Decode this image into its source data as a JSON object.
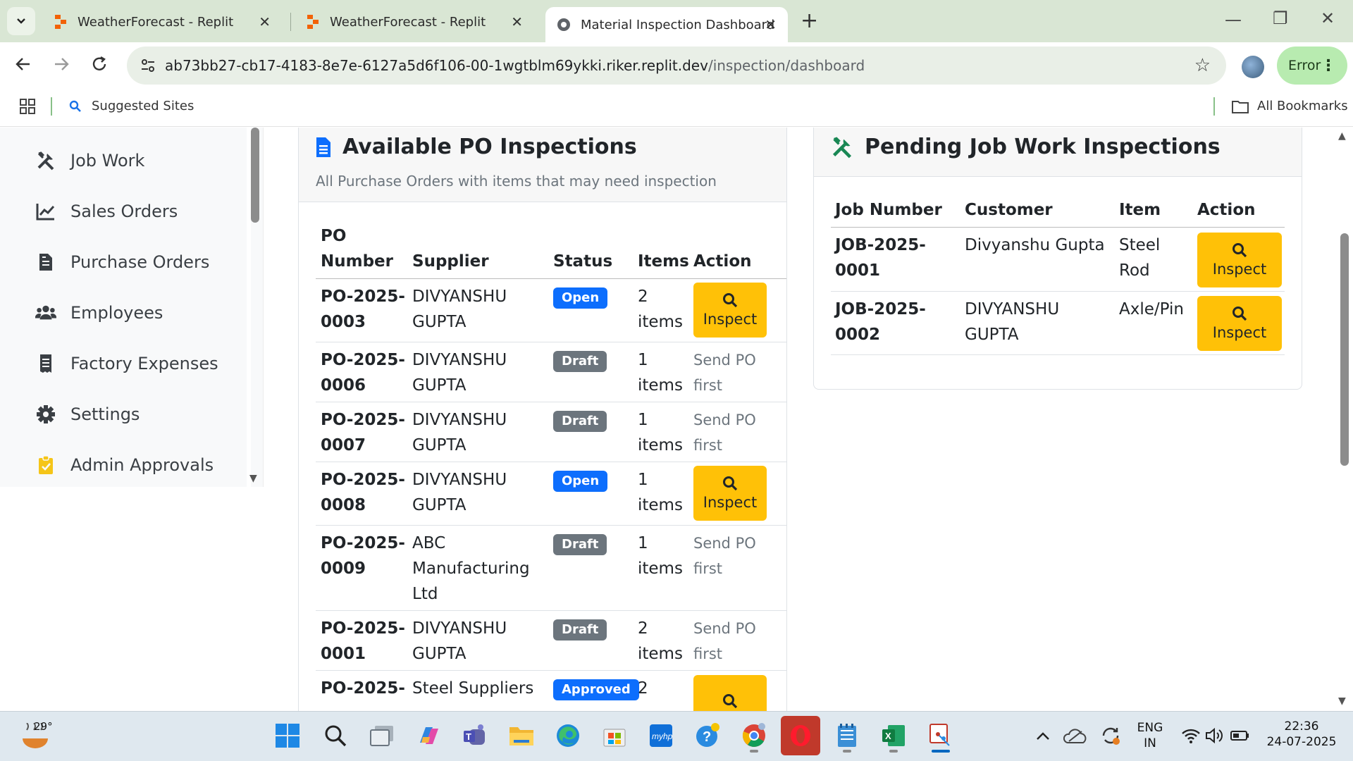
{
  "browser": {
    "tabs": [
      {
        "title": "WeatherForecast - Replit",
        "active": false
      },
      {
        "title": "WeatherForecast - Replit",
        "active": false
      },
      {
        "title": "Material Inspection Dashboard",
        "active": true
      }
    ],
    "new_tab": "+",
    "url_host": "ab73bb27-cb17-4183-8e7e-6127a5d6f106-00-1wgtblm69ykki.riker.replit.dev",
    "url_path": "/inspection/dashboard",
    "error_label": "Error",
    "bookmarks": {
      "suggested": "Suggested Sites",
      "all": "All Bookmarks"
    }
  },
  "sidebar": {
    "items": [
      {
        "label": "Job Work",
        "icon": "tools-icon"
      },
      {
        "label": "Sales Orders",
        "icon": "chart-line-icon"
      },
      {
        "label": "Purchase Orders",
        "icon": "file-invoice-icon"
      },
      {
        "label": "Employees",
        "icon": "users-icon"
      },
      {
        "label": "Factory Expenses",
        "icon": "receipt-icon"
      },
      {
        "label": "Settings",
        "icon": "gear-icon"
      },
      {
        "label": "Admin Approvals",
        "icon": "clipboard-check-icon"
      }
    ]
  },
  "po_card": {
    "title": "Available PO Inspections",
    "subtitle": "All Purchase Orders with items that may need inspection",
    "headers": {
      "po_line1": "PO",
      "po_line2": "Number",
      "supplier": "Supplier",
      "status": "Status",
      "items": "Items",
      "action": "Action"
    },
    "rows": [
      {
        "po1": "PO-2025-",
        "po2": "0003",
        "supplier": [
          "DIVYANSHU",
          "GUPTA"
        ],
        "status": "Open",
        "items1": "2",
        "items2": "items",
        "action": "Inspect"
      },
      {
        "po1": "PO-2025-",
        "po2": "0006",
        "supplier": [
          "DIVYANSHU",
          "GUPTA"
        ],
        "status": "Draft",
        "items1": "1",
        "items2": "items",
        "action1": "Send PO",
        "action2": "first"
      },
      {
        "po1": "PO-2025-",
        "po2": "0007",
        "supplier": [
          "DIVYANSHU",
          "GUPTA"
        ],
        "status": "Draft",
        "items1": "1",
        "items2": "items",
        "action1": "Send PO",
        "action2": "first"
      },
      {
        "po1": "PO-2025-",
        "po2": "0008",
        "supplier": [
          "DIVYANSHU",
          "GUPTA"
        ],
        "status": "Open",
        "items1": "1",
        "items2": "items",
        "action": "Inspect"
      },
      {
        "po1": "PO-2025-",
        "po2": "0009",
        "supplier": [
          "ABC",
          "Manufacturing",
          "Ltd"
        ],
        "status": "Draft",
        "items1": "1",
        "items2": "items",
        "action1": "Send PO",
        "action2": "first"
      },
      {
        "po1": "PO-2025-",
        "po2": "0001",
        "supplier": [
          "DIVYANSHU",
          "GUPTA"
        ],
        "status": "Draft",
        "items1": "2",
        "items2": "items",
        "action1": "Send PO",
        "action2": "first"
      },
      {
        "po1": "PO-2025-",
        "supplier": [
          "Steel Suppliers"
        ],
        "status": "Approved",
        "items1": "2"
      }
    ]
  },
  "job_card": {
    "title": "Pending Job Work Inspections",
    "headers": {
      "job_number": "Job Number",
      "customer": "Customer",
      "item": "Item",
      "action": "Action"
    },
    "rows": [
      {
        "job1": "JOB-2025-",
        "job2": "0001",
        "customer": [
          "Divyanshu Gupta"
        ],
        "item": [
          "Steel",
          "Rod"
        ],
        "action": "Inspect"
      },
      {
        "job1": "JOB-2025-",
        "job2": "0002",
        "customer": [
          "DIVYANSHU",
          "GUPTA"
        ],
        "item": [
          "Axle/Pin"
        ],
        "action": "Inspect"
      }
    ]
  },
  "taskbar": {
    "temperature": "29°",
    "language": "ENG",
    "region": "IN",
    "time": "22:36",
    "date": "24-07-2025"
  },
  "colors": {
    "primary": "#0d6efd",
    "secondary": "#6c757d",
    "warning": "#ffc107",
    "success_icon": "#198754"
  }
}
